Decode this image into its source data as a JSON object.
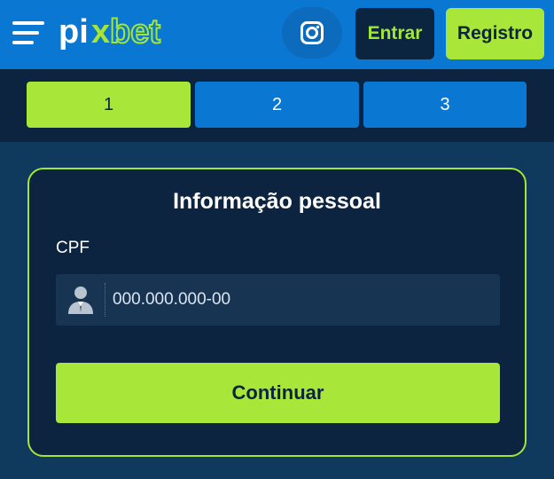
{
  "header": {
    "logo_text": "pixbet",
    "menu_icon": "hamburger-menu-icon",
    "instagram_icon": "instagram-icon",
    "login_label": "Entrar",
    "register_label": "Registro"
  },
  "steps": [
    {
      "label": "1",
      "active": true
    },
    {
      "label": "2",
      "active": false
    },
    {
      "label": "3",
      "active": false
    }
  ],
  "form": {
    "title": "Informação pessoal",
    "cpf_label": "CPF",
    "cpf_value": "",
    "cpf_placeholder": "000.000.000-00",
    "user_icon": "user-icon",
    "submit_label": "Continuar"
  },
  "colors": {
    "header_blue": "#0a78d2",
    "accent_green": "#a8e63a",
    "navy": "#0c2440",
    "background": "#0f3a5e"
  }
}
